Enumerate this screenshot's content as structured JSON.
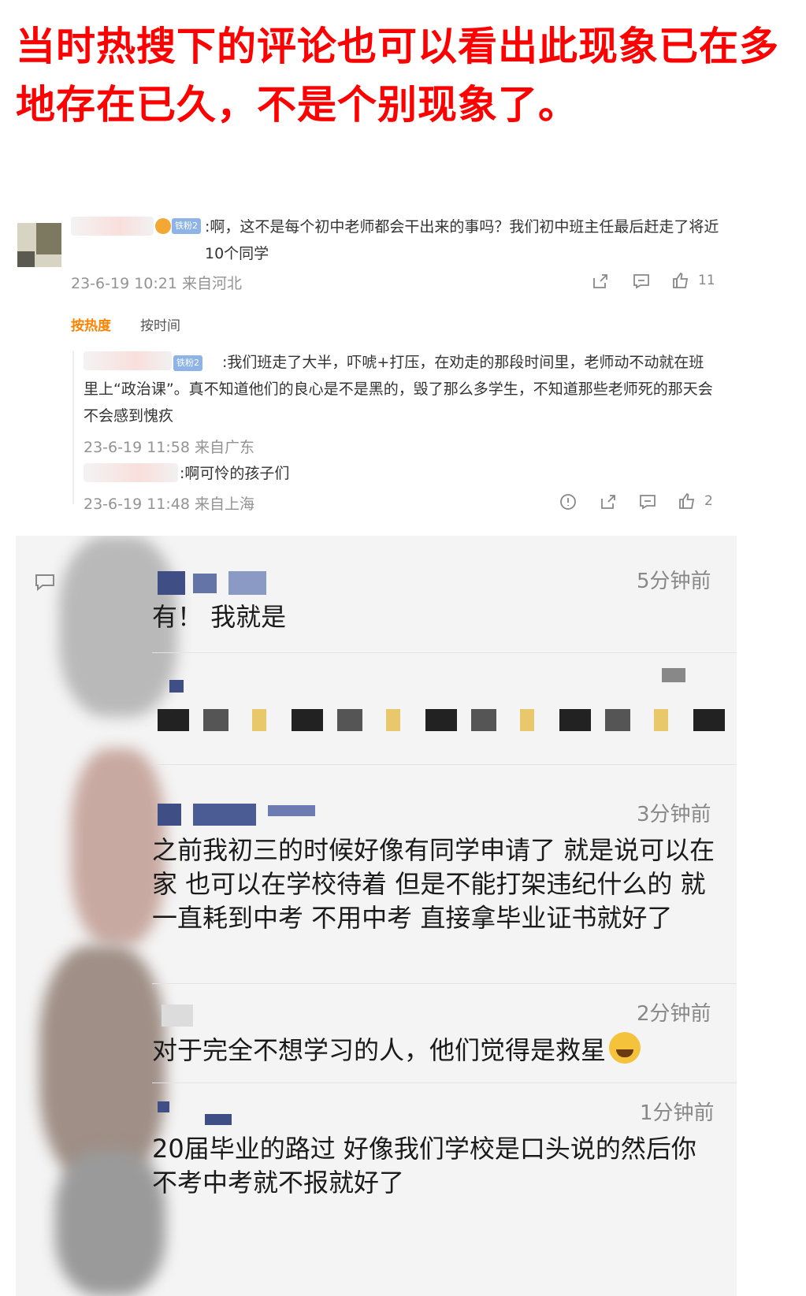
{
  "headline": "当时热搜下的评论也可以看出此现象已在多地存在已久，不是个别现象了。",
  "weibo": {
    "comment": {
      "badge": "铁粉2",
      "text": ":啊，这不是每个初中老师都会干出来的事吗？我们初中班主任最后赶走了将近10个同学",
      "meta": "23-6-19 10:21 来自河北",
      "likes": "11"
    },
    "sort": {
      "hot": "按热度",
      "time": "按时间"
    },
    "replies": [
      {
        "badge": "铁粉2",
        "text": ":我们班走了大半，吓唬+打压，在劝走的那段时间里，老师动不动就在班里上“政治课”。真不知道他们的良心是不是黑的，毁了那么多学生，不知道那些老师死的那天会不会感到愧疚",
        "meta": "23-6-19 11:58 来自广东"
      },
      {
        "text": ":啊可怜的孩子们",
        "meta": "23-6-19 11:48 来自上海",
        "likes": "2"
      }
    ]
  },
  "app": {
    "comments": [
      {
        "time": "5分钟前",
        "text": "有！ 我就是"
      },
      {
        "time": "3分钟前",
        "text": "之前我初三的时候好像有同学申请了 就是说可以在家 也可以在学校待着 但是不能打架违纪什么的 就一直耗到中考 不用中考 直接拿毕业证书就好了"
      },
      {
        "time": "2分钟前",
        "text": "对于完全不想学习的人，他们觉得是救星"
      },
      {
        "time": "1分钟前",
        "text": "20届毕业的路过 好像我们学校是口头说的然后你不考中考就不报就好了"
      }
    ]
  },
  "colors": {
    "headline": "#ff0000",
    "weibo_orange": "#ff8200",
    "fan_badge": "#8eb3e6"
  }
}
